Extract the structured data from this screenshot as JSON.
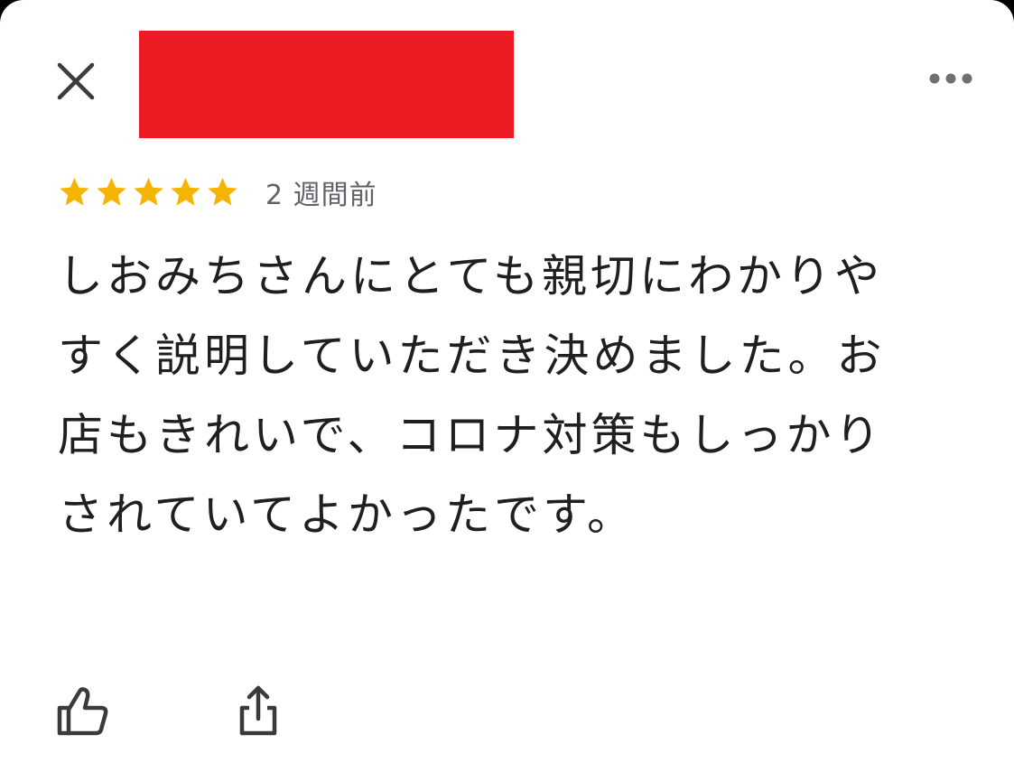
{
  "header": {
    "close_icon": "close-icon",
    "more_icon": "more-horizontal-icon",
    "redaction_color": "#ed1c24"
  },
  "review": {
    "rating": 5,
    "max_rating": 5,
    "star_color": "#f4b400",
    "time": "2 週間前",
    "text": "しおみちさんにとても親切にわかりやすく説明していただき決めました。お店もきれいで、コロナ対策もしっかりされていてよかったです。"
  },
  "actions": {
    "like_icon": "thumbs-up-icon",
    "share_icon": "share-icon"
  }
}
